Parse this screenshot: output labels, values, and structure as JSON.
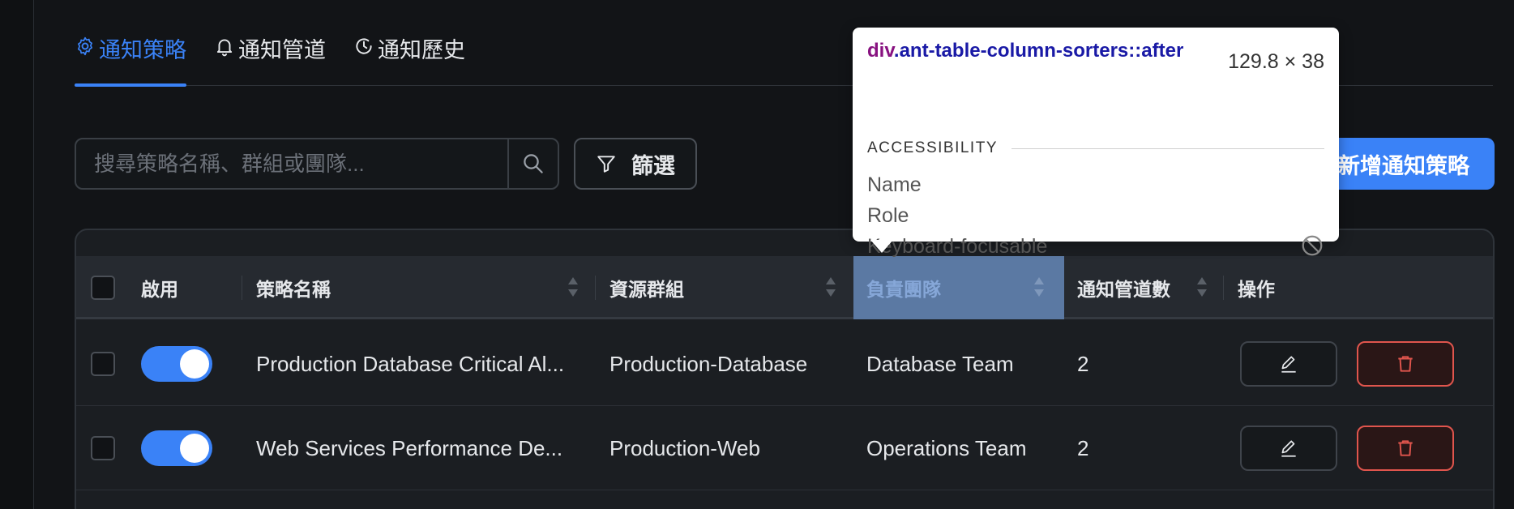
{
  "tabs": [
    {
      "label": "通知策略",
      "icon": "gear-icon",
      "active": true
    },
    {
      "label": "通知管道",
      "icon": "bell-icon",
      "active": false
    },
    {
      "label": "通知歷史",
      "icon": "history-clock-icon",
      "active": false
    }
  ],
  "search": {
    "placeholder": "搜尋策略名稱、群組或團隊..."
  },
  "filter": {
    "label": "篩選"
  },
  "new_button": {
    "label": "新增通知策略"
  },
  "table": {
    "headers": {
      "enabled": "啟用",
      "policy_name": "策略名稱",
      "resource_group": "資源群組",
      "team": "負責團隊",
      "channel_count": "通知管道數",
      "actions": "操作"
    },
    "rows": [
      {
        "enabled": true,
        "policy_name": "Production Database Critical Al...",
        "resource_group": "Production-Database",
        "team": "Database Team",
        "channel_count": "2"
      },
      {
        "enabled": true,
        "policy_name": "Web Services Performance De...",
        "resource_group": "Production-Web",
        "team": "Operations Team",
        "channel_count": "2"
      }
    ]
  },
  "tooltip": {
    "selector_tag": "div",
    "selector_rest": ".ant-table-column-sorters::after",
    "size": "129.8 × 38",
    "section": "ACCESSIBILITY",
    "props": [
      "Name",
      "Role",
      "Keyboard-focusable"
    ]
  },
  "colors": {
    "accent": "#3a82f7",
    "danger": "#e0554d",
    "highlight": "#5b79a3"
  }
}
